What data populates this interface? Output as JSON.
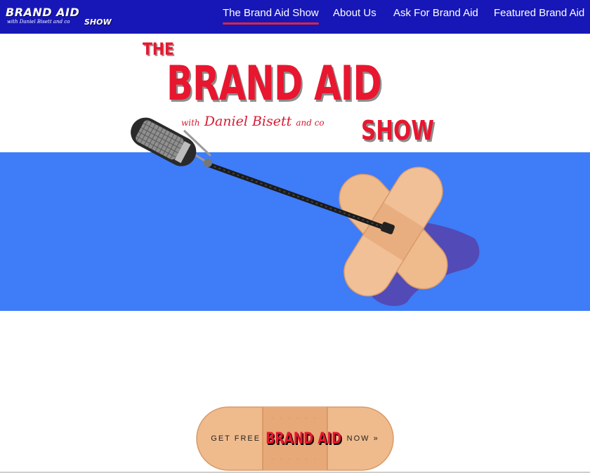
{
  "header": {
    "logo": {
      "line1": "BRAND AID",
      "line2": "with Daniel Bisett and co",
      "line3": "SHOW"
    },
    "nav": [
      {
        "label": "The Brand Aid Show",
        "active": true
      },
      {
        "label": "About Us",
        "active": false
      },
      {
        "label": "Ask For Brand Aid",
        "active": false
      },
      {
        "label": "Featured Brand Aid",
        "active": false
      }
    ],
    "accent_underline": "#e0243a",
    "background": "#1717b8"
  },
  "hero": {
    "title_the": "THE",
    "title_main": "BRAND AID",
    "byline_with": "with",
    "byline_name": "Daniel Bisett",
    "byline_and": "and co",
    "title_show": "SHOW",
    "band_color": "#3e7cf8",
    "title_color": "#e8162f"
  },
  "cta": {
    "prefix": "GET FREE",
    "brand": "BRAND AID",
    "suffix": "NOW »"
  }
}
